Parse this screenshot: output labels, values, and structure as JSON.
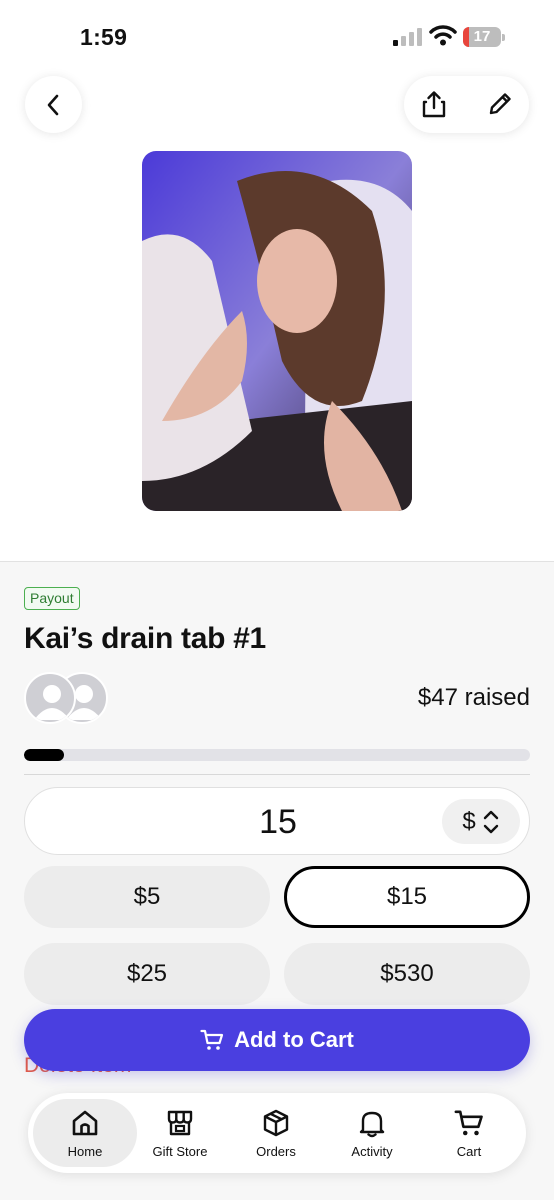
{
  "status_bar": {
    "time": "1:59",
    "battery_level": "17"
  },
  "product": {
    "badge": "Payout",
    "title": "Kai’s drain tab #1",
    "raised": "$47 raised",
    "progress_fraction": 0.08
  },
  "amount": {
    "value": "15",
    "currency": "$"
  },
  "presets": [
    "$5",
    "$15",
    "$25",
    "$530"
  ],
  "selected_preset": "$15",
  "delete_label": "Delete Item",
  "add_to_cart_label": "Add to Cart",
  "tabs": [
    {
      "label": "Home",
      "icon": "home-icon",
      "active": true
    },
    {
      "label": "Gift Store",
      "icon": "store-icon",
      "active": false
    },
    {
      "label": "Orders",
      "icon": "box-icon",
      "active": false
    },
    {
      "label": "Activity",
      "icon": "bell-icon",
      "active": false
    },
    {
      "label": "Cart",
      "icon": "cart-icon",
      "active": false
    }
  ],
  "colors": {
    "accent": "#4a3fe0",
    "payout_green": "#2e7d32",
    "delete_red": "#e25c4a",
    "battery_low": "#e8453c"
  }
}
